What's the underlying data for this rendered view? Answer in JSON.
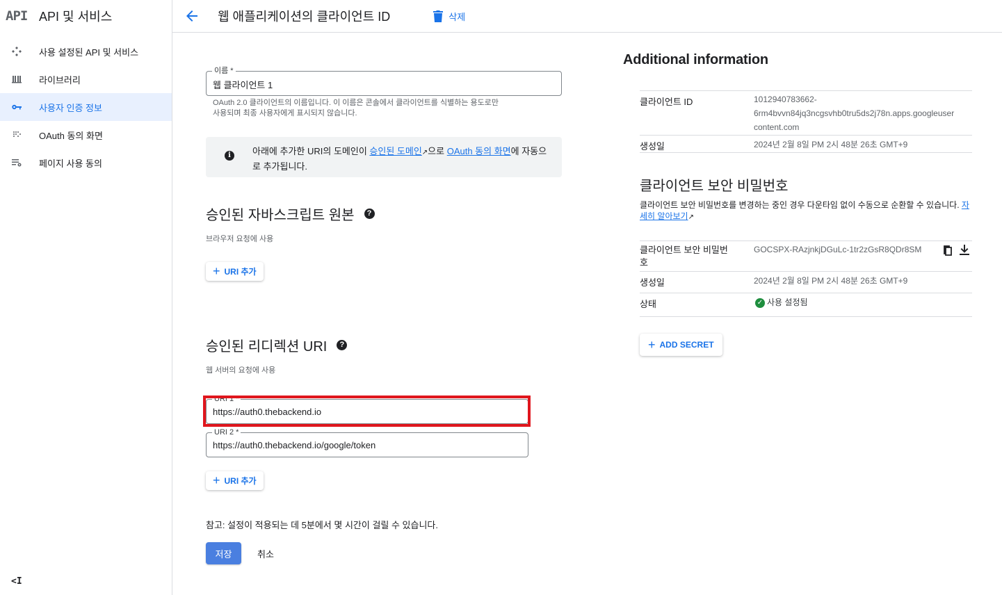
{
  "colors": {
    "accent": "#1a73e8",
    "highlight": "#e0161d",
    "success": "#1e8e3e",
    "save_button": "#4a7fe0"
  },
  "sidebar": {
    "logo": "API",
    "title": "API 및 서비스",
    "items": [
      {
        "label": "사용 설정된 API 및 서비스",
        "icon": "apis-icon"
      },
      {
        "label": "라이브러리",
        "icon": "library-icon"
      },
      {
        "label": "사용자 인증 정보",
        "icon": "key-icon",
        "active": true
      },
      {
        "label": "OAuth 동의 화면",
        "icon": "consent-icon"
      },
      {
        "label": "페이지 사용 동의",
        "icon": "page-agreement-icon"
      }
    ],
    "collapse_label": "<I"
  },
  "header": {
    "title": "웹 애플리케이션의 클라이언트 ID",
    "delete_label": "삭제"
  },
  "form": {
    "name_label": "이름 *",
    "name_value": "웹 클라이언트 1",
    "name_hint_1": "OAuth 2.0 클라이언트의 이름입니다. 이 이름은 콘솔에서 클라이언트를 식별하는 용도로만",
    "name_hint_2": "사용되며 최종 사용자에게 표시되지 않습니다.",
    "info_pre": "아래에 추가한 URI의 도메인이 ",
    "info_link1": "승인된 도메인",
    "info_mid": "으로 ",
    "info_link2": "OAuth 동의 화면",
    "info_post": "에 자동으로 추가됩니다.",
    "js_title": "승인된 자바스크립트 원본",
    "js_sub": "브라우저 요청에 사용",
    "add_uri_label": "URI 추가",
    "redirect_title": "승인된 리디렉션 URI",
    "redirect_sub": "웹 서버의 요청에 사용",
    "uri1_label": "URI 1 *",
    "uri1_value": "https://auth0.thebackend.io",
    "uri2_label": "URI 2 *",
    "uri2_value": "https://auth0.thebackend.io/google/token",
    "note": "참고: 설정이 적용되는 데 5분에서 몇 시간이 걸릴 수 있습니다.",
    "save_label": "저장",
    "cancel_label": "취소"
  },
  "info_panel": {
    "title": "Additional information",
    "client_id_label": "클라이언트 ID",
    "client_id_line1": "1012940783662-",
    "client_id_line2": "6rm4bvvn84jq3ncgsvhb0tru5ds2j78n.apps.googleuser",
    "client_id_line3": "content.com",
    "created_label": "생성일",
    "created_value": "2024년 2월 8일 PM 2시 48분 26초 GMT+9",
    "secret_title": "클라이언트 보안 비밀번호",
    "secret_desc": "클라이언트 보안 비밀번호를 변경하는 중인 경우 다운타임 없이 수동으로 순환할 수 있습니다.",
    "learn_more": "자세히 알아보기",
    "secret_label_1": "클라이언트 보안 비밀번",
    "secret_label_2": "호",
    "secret_value": "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",
    "secret_created_label": "생성일",
    "secret_created_value": "2024년 2월 8일 PM 2시 48분 26초 GMT+9",
    "status_label": "상태",
    "status_value": "사용 설정됨",
    "add_secret_label": "ADD SECRET"
  }
}
